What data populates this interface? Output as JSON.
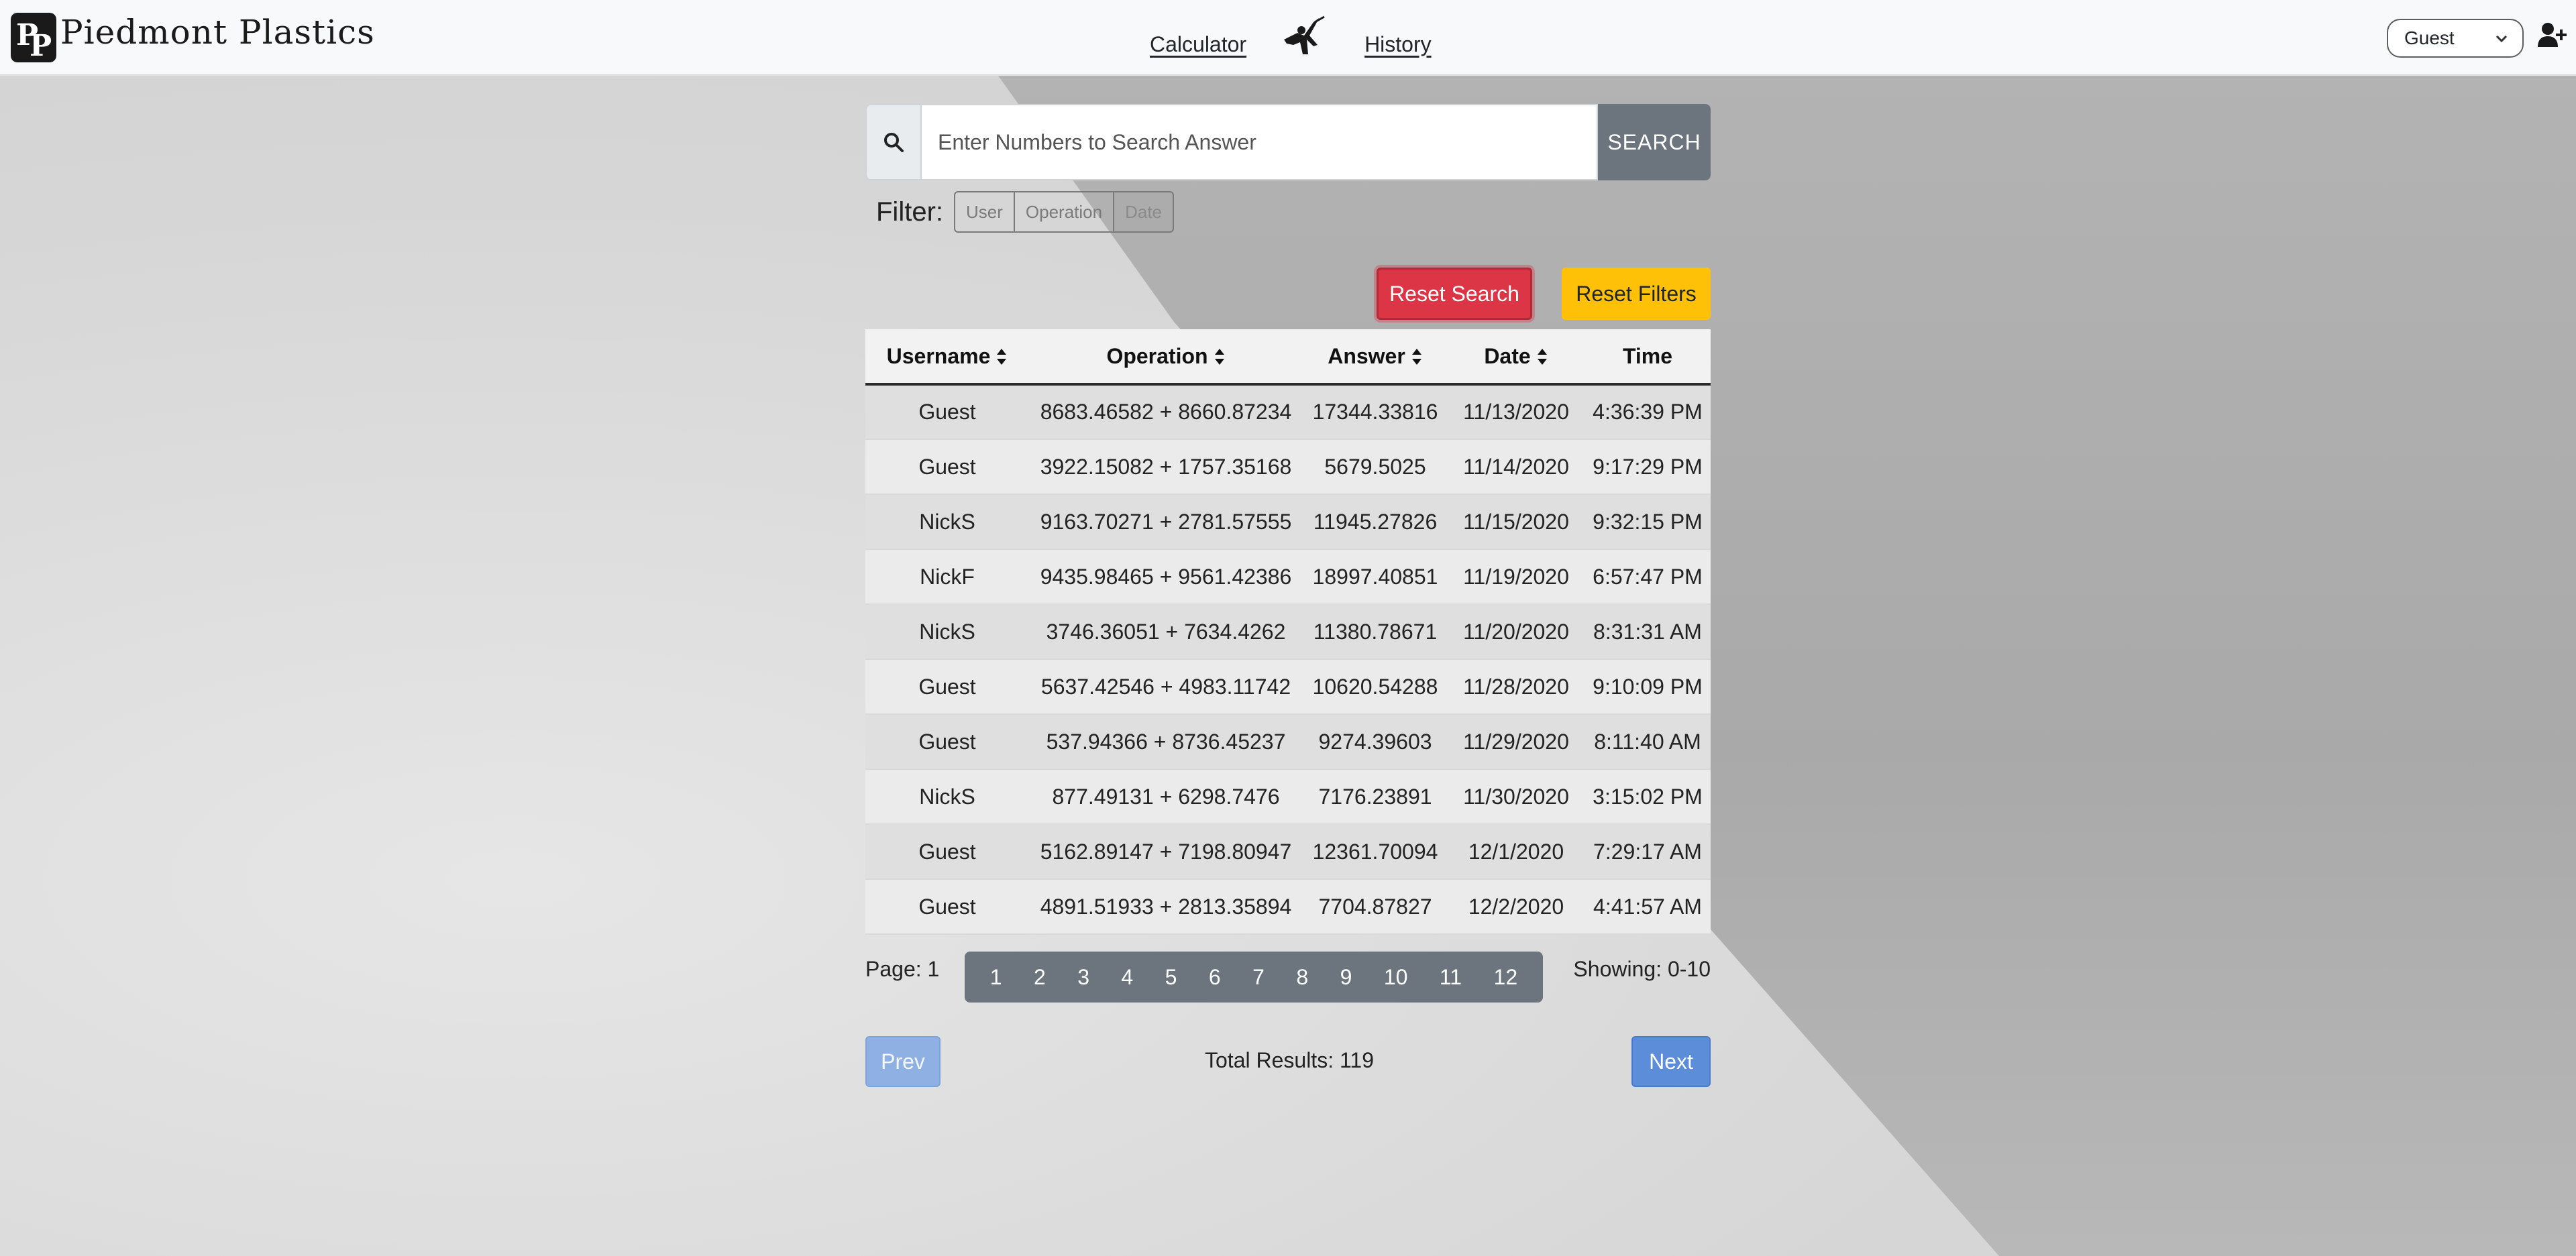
{
  "brand": {
    "name": "Piedmont Plastics",
    "logo_text": "PP"
  },
  "nav": {
    "calculator": "Calculator",
    "history": "History"
  },
  "user_select": {
    "value": "Guest"
  },
  "search": {
    "placeholder": "Enter Numbers to Search Answer",
    "button": "SEARCH"
  },
  "filter": {
    "label": "Filter:",
    "options": [
      "User",
      "Operation",
      "Date"
    ]
  },
  "actions": {
    "reset_search": "Reset Search",
    "reset_filters": "Reset Filters"
  },
  "table": {
    "headers": [
      "Username",
      "Operation",
      "Answer",
      "Date",
      "Time"
    ],
    "rows": [
      [
        "Guest",
        "8683.46582 + 8660.87234",
        "17344.33816",
        "11/13/2020",
        "4:36:39 PM"
      ],
      [
        "Guest",
        "3922.15082 + 1757.35168",
        "5679.5025",
        "11/14/2020",
        "9:17:29 PM"
      ],
      [
        "NickS",
        "9163.70271 + 2781.57555",
        "11945.27826",
        "11/15/2020",
        "9:32:15 PM"
      ],
      [
        "NickF",
        "9435.98465 + 9561.42386",
        "18997.40851",
        "11/19/2020",
        "6:57:47 PM"
      ],
      [
        "NickS",
        "3746.36051 + 7634.4262",
        "11380.78671",
        "11/20/2020",
        "8:31:31 AM"
      ],
      [
        "Guest",
        "5637.42546 + 4983.11742",
        "10620.54288",
        "11/28/2020",
        "9:10:09 PM"
      ],
      [
        "Guest",
        "537.94366 + 8736.45237",
        "9274.39603",
        "11/29/2020",
        "8:11:40 AM"
      ],
      [
        "NickS",
        "877.49131 + 6298.7476",
        "7176.23891",
        "11/30/2020",
        "3:15:02 PM"
      ],
      [
        "Guest",
        "5162.89147 + 7198.80947",
        "12361.70094",
        "12/1/2020",
        "7:29:17 AM"
      ],
      [
        "Guest",
        "4891.51933 + 2813.35894",
        "7704.87827",
        "12/2/2020",
        "4:41:57 AM"
      ]
    ]
  },
  "pagination": {
    "page_label": "Page: 1",
    "pages": [
      "1",
      "2",
      "3",
      "4",
      "5",
      "6",
      "7",
      "8",
      "9",
      "10",
      "11",
      "12"
    ],
    "showing": "Showing: 0-10",
    "prev": "Prev",
    "next": "Next",
    "total": "Total Results: 119"
  },
  "icons": {
    "search": "search-icon",
    "sort": "sort-icon",
    "add_user": "user-plus-icon",
    "chevron": "chevron-down-icon",
    "mascot": "mascot-icon"
  },
  "colors": {
    "danger": "#dc3545",
    "warning": "#ffc107",
    "secondary": "#6c757d",
    "primary": "#5b8dd9"
  }
}
